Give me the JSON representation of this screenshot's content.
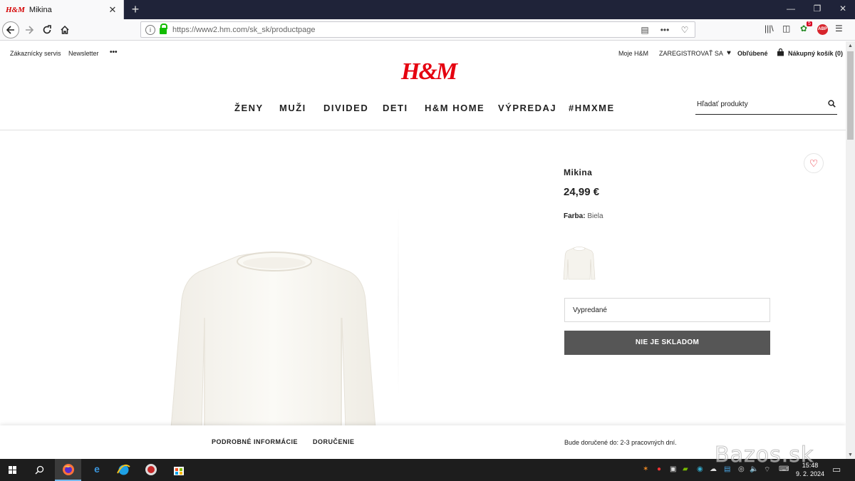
{
  "browser": {
    "tab": {
      "favicon_text": "H&M",
      "title": "Mikina",
      "close": "✕"
    },
    "new_tab": "+",
    "window": {
      "minimize": "—",
      "restore": "❐",
      "close": "✕"
    },
    "url": "https://www2.hm.com/sk_sk/productpage",
    "ext_badge": "5",
    "abp_label": "ABP"
  },
  "header": {
    "util_left": [
      "Zákaznícky servis",
      "Newsletter",
      "•••"
    ],
    "util_right": {
      "account": "Moje H&M",
      "register": "ZAREGISTROVAŤ SA",
      "favorites": "Obľúbené",
      "cart": "Nákupný košík (0)"
    },
    "logo": "H&M",
    "nav": [
      "ŽENY",
      "MUŽI",
      "DIVIDED",
      "DETI",
      "H&M HOME",
      "VÝPREDAJ",
      "#HMXME"
    ],
    "search_placeholder": "Hľadať produkty"
  },
  "product": {
    "name": "Mikina",
    "price": "24,99 €",
    "color_label": "Farba:",
    "color_value": "Biela",
    "size_status": "Vypredané",
    "stock_button": "NIE JE SKLADOM"
  },
  "bottom": {
    "details": "PODROBNÉ INFORMÁCIE",
    "delivery": "DORUČENIE",
    "delivery_note": "Bude doručené do: 2-3 pracovných dní."
  },
  "taskbar": {
    "time": "15:48",
    "date": "9. 2. 2024"
  },
  "watermark": "Bazos.sk",
  "colors": {
    "brand": "#e50010",
    "button": "#565656",
    "taskbar": "#1d1d1d",
    "tabbar": "#1f2339"
  }
}
